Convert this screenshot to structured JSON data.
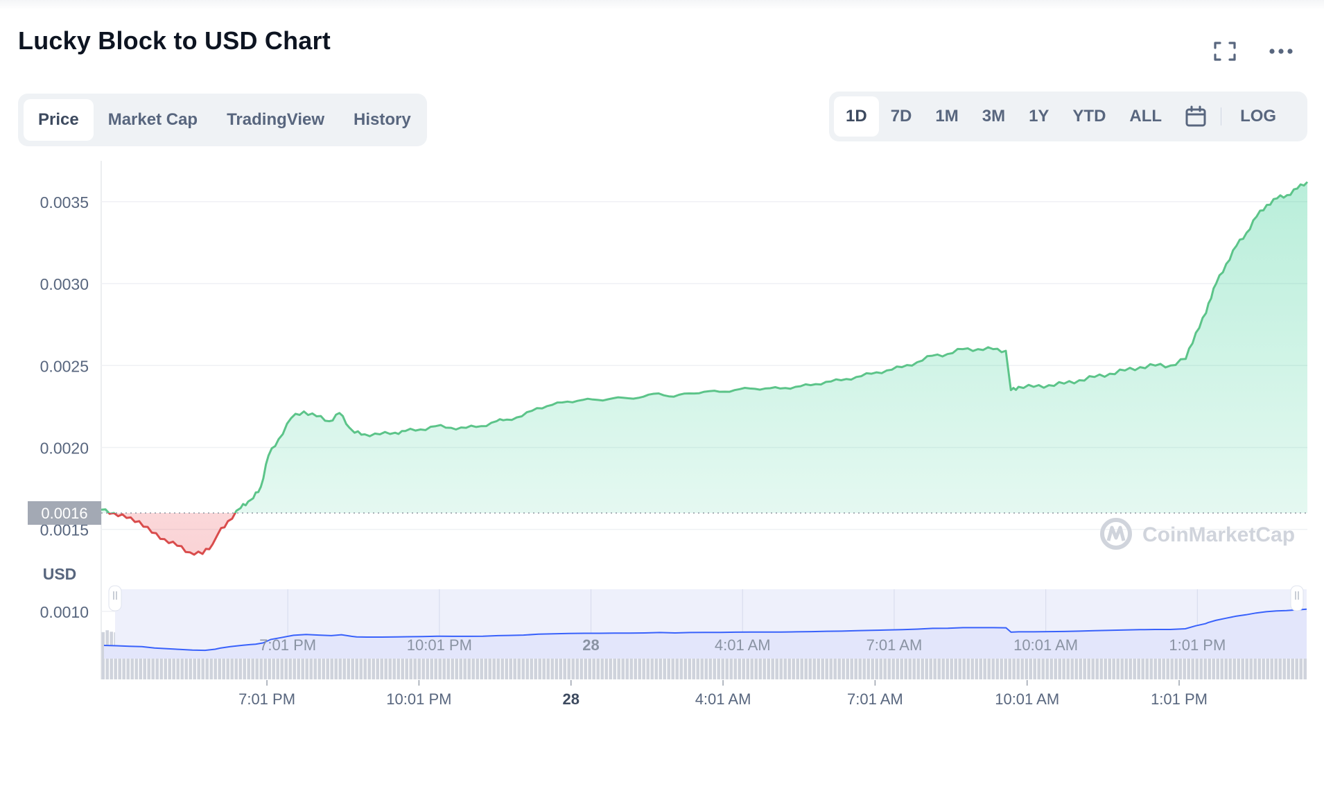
{
  "header": {
    "title": "Lucky Block to USD Chart"
  },
  "view_tabs": [
    {
      "label": "Price",
      "active": true
    },
    {
      "label": "Market Cap",
      "active": false
    },
    {
      "label": "TradingView",
      "active": false
    },
    {
      "label": "History",
      "active": false
    }
  ],
  "range_tabs": [
    {
      "label": "1D",
      "active": true
    },
    {
      "label": "7D",
      "active": false
    },
    {
      "label": "1M",
      "active": false
    },
    {
      "label": "3M",
      "active": false
    },
    {
      "label": "1Y",
      "active": false
    },
    {
      "label": "YTD",
      "active": false
    },
    {
      "label": "ALL",
      "active": false
    }
  ],
  "log_label": "LOG",
  "icons": {
    "expand": "expand-icon",
    "more": "more-dots-icon",
    "calendar": "calendar-icon"
  },
  "colors": {
    "up": "#16c784",
    "up_line": "#5cc489",
    "down_line": "#d94c4c",
    "volume": "#cfd3dc",
    "navigator_line": "#3861fb",
    "navigator_fill": "#e6e9fb",
    "reference_badge": "#a3a9b4"
  },
  "chart_data": {
    "type": "area",
    "title": "Lucky Block to USD Chart",
    "xlabel": "",
    "ylabel": "USD",
    "ylim": [
      0.0005,
      0.0038
    ],
    "y_ticks": [
      "0.0035",
      "0.0030",
      "0.0025",
      "0.0020",
      "0.0015",
      "0.0010"
    ],
    "x_tick_labels": [
      "7:01 PM",
      "10:01 PM",
      "28",
      "4:01 AM",
      "7:01 AM",
      "10:01 AM",
      "1:01 PM"
    ],
    "x_tick_hours": [
      3.27,
      6.27,
      9.27,
      12.27,
      15.27,
      18.27,
      21.27
    ],
    "reference_price": 0.0016,
    "reference_label": "0.0016",
    "watermark": "CoinMarketCap",
    "grid": true,
    "price_series": {
      "name": "Price",
      "hours": [
        0,
        0.25,
        0.5,
        0.75,
        1,
        1.25,
        1.5,
        1.75,
        2,
        2.2,
        2.3,
        2.5,
        2.75,
        2.9,
        3,
        3.15,
        3.3,
        3.5,
        3.75,
        4,
        4.25,
        4.5,
        4.7,
        4.9,
        5,
        5.2,
        5.5,
        5.8,
        6,
        6.3,
        6.6,
        6.9,
        7.2,
        7.5,
        7.8,
        8,
        8.3,
        8.6,
        8.9,
        9.2,
        9.5,
        9.8,
        10.1,
        10.4,
        10.7,
        11,
        11.3,
        11.6,
        11.9,
        12.2,
        12.5,
        12.8,
        13.1,
        13.4,
        13.7,
        14,
        14.3,
        14.6,
        14.9,
        15.2,
        15.5,
        15.8,
        16.1,
        16.4,
        16.7,
        17,
        17.3,
        17.6,
        17.85,
        17.95,
        18.1,
        18.4,
        18.7,
        19,
        19.3,
        19.6,
        19.9,
        20.2,
        20.5,
        20.8,
        21.1,
        21.4,
        21.6,
        21.8,
        21.85,
        22,
        22.2,
        22.4,
        22.6,
        22.8,
        23,
        23.2,
        23.4,
        23.6,
        23.8
      ],
      "values": [
        0.00162,
        0.0016,
        0.00157,
        0.00155,
        0.00148,
        0.00144,
        0.0014,
        0.00136,
        0.00135,
        0.00141,
        0.00147,
        0.00155,
        0.00163,
        0.00167,
        0.00169,
        0.00176,
        0.00195,
        0.00205,
        0.00218,
        0.00222,
        0.00219,
        0.00216,
        0.00221,
        0.00212,
        0.00209,
        0.00208,
        0.00208,
        0.00209,
        0.0021,
        0.00211,
        0.00213,
        0.00212,
        0.00212,
        0.00213,
        0.00216,
        0.00217,
        0.00219,
        0.00224,
        0.00226,
        0.00228,
        0.00229,
        0.00229,
        0.0023,
        0.0023,
        0.00231,
        0.00233,
        0.00231,
        0.00233,
        0.00234,
        0.00234,
        0.00235,
        0.00236,
        0.00236,
        0.00236,
        0.00237,
        0.00238,
        0.0024,
        0.00241,
        0.00243,
        0.00245,
        0.00247,
        0.00249,
        0.00252,
        0.00256,
        0.00257,
        0.0026,
        0.0026,
        0.0026,
        0.00259,
        0.00235,
        0.00237,
        0.00237,
        0.00238,
        0.00239,
        0.00241,
        0.00243,
        0.00245,
        0.00247,
        0.00249,
        0.0025,
        0.0025,
        0.00254,
        0.0027,
        0.00282,
        0.00288,
        0.003,
        0.00312,
        0.00323,
        0.00331,
        0.00341,
        0.00348,
        0.00352,
        0.00354,
        0.00358,
        0.00362
      ]
    },
    "volume_series": {
      "name": "Volume",
      "hours": [
        0,
        1,
        2,
        3,
        4,
        5,
        6,
        7,
        8,
        9,
        9.2,
        10,
        12,
        14,
        16,
        17,
        18,
        19,
        20,
        21,
        22,
        23,
        23.8
      ],
      "values": [
        0.5,
        0.55,
        0.6,
        0.68,
        0.75,
        0.78,
        0.8,
        0.82,
        0.84,
        0.85,
        0.55,
        0.56,
        0.56,
        0.57,
        0.58,
        0.59,
        0.61,
        0.62,
        0.63,
        0.64,
        0.66,
        0.8,
        0.88
      ]
    }
  }
}
